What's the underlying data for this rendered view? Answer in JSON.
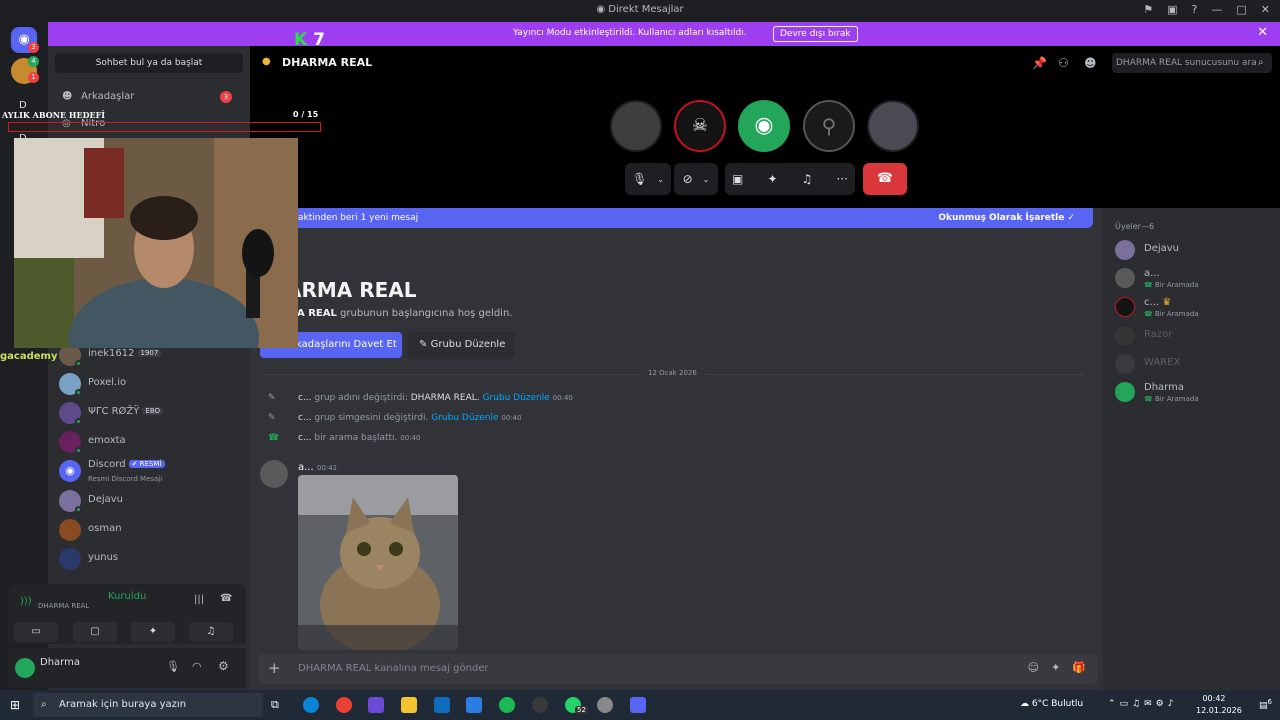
{
  "window": {
    "title": "Direkt Mesajlar"
  },
  "streamer_banner": {
    "message": "Yayıncı Modu etkinleştirildi. Kullanıcı adları kısaltıldı.",
    "button": "Devre dışı bırak"
  },
  "guilds": {
    "badge_1": "3",
    "badge_2": "4",
    "badge_3": "1",
    "letter_1": "D",
    "letter_2": "D"
  },
  "dm_sidebar": {
    "search_placeholder": "Sohbet bul ya da başlat",
    "friends_label": "Arkadaşlar",
    "friends_badge": "3",
    "nitro_label": "Nitro",
    "items": [
      {
        "name": "inek1612",
        "badge": "1907"
      },
      {
        "name": "Poxel.io"
      },
      {
        "name": "ΨΓC RØŽŸ",
        "badge": "EBO"
      },
      {
        "name": "emoxta"
      },
      {
        "name": "Discord",
        "badge": "✔ RESMİ",
        "sub": "Resmi Discord Mesajı"
      },
      {
        "name": "Dejavu"
      },
      {
        "name": "osman"
      },
      {
        "name": "yunus"
      }
    ]
  },
  "voice_panel": {
    "status": "Kuruldu",
    "channel": "DHARMA REAL"
  },
  "user_panel": {
    "name": "Dharma"
  },
  "channel_header": {
    "group_name": "DHARMA REAL",
    "search_placeholder": "DHARMA REAL sunucusunu ara"
  },
  "new_messages_bar": {
    "left_text": "aktinden beri 1 yeni mesaj",
    "right_text": "Okunmuş Olarak İşaretle"
  },
  "welcome": {
    "title": "ARMA REAL",
    "text_bold": "A REAL",
    "text_rest": " grubunun başlangıcına hoş geldin.",
    "invite_button": "kadaşlarını Davet Et",
    "edit_button": "Grubu Düzenle"
  },
  "date_divider": "12 Ocak 2026",
  "system_messages": [
    {
      "user": "c...",
      "action": "grup adını değiştirdi:",
      "value": "DHARMA REAL.",
      "link": "Grubu Düzenle",
      "time": "00:40"
    },
    {
      "user": "c...",
      "action": "grup simgesini değiştirdi.",
      "link": "Grubu Düzenle",
      "time": "00:40"
    },
    {
      "user": "c...",
      "action": "bir arama başlattı.",
      "time": "00:40"
    }
  ],
  "message": {
    "author": "a...",
    "time": "00:41"
  },
  "composer": {
    "placeholder": "DHARMA REAL kanalına mesaj gönder"
  },
  "members": {
    "header": "Üyeler—6",
    "list": [
      {
        "name": "Dejavu"
      },
      {
        "name": "a...",
        "activity": "Bir Aramada"
      },
      {
        "name": "c...",
        "activity": "Bir Aramada"
      },
      {
        "name": "Razor"
      },
      {
        "name": "WAREX"
      },
      {
        "name": "Dharma",
        "activity": "Bir Aramada"
      }
    ]
  },
  "overlay": {
    "goal_label": "AYLIK ABONE HEDEFİ",
    "goal_count": "0 / 15",
    "k_letter": "K",
    "k_number": "7",
    "academy_text": "gacademy"
  },
  "taskbar": {
    "search_placeholder": "Aramak için buraya yazın",
    "weather": "6°C  Bulutlu",
    "time": "00:42",
    "date": "12.01.2026",
    "whatsapp_badge": "52",
    "notif_count": "6"
  },
  "colors": {
    "brand": "#5865f2",
    "streamer_mode": "#9d3ff1",
    "online": "#23a55a",
    "danger": "#da373c"
  }
}
